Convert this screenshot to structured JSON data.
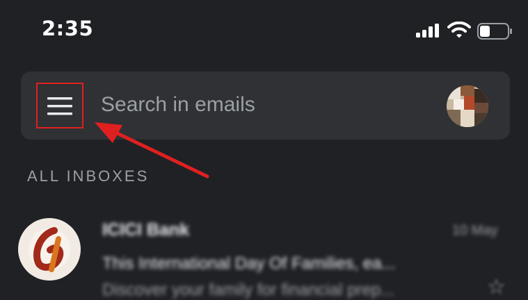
{
  "status_bar": {
    "time": "2:35",
    "icons": [
      "cellular-signal-icon",
      "wifi-icon",
      "battery-icon"
    ]
  },
  "search_bar": {
    "menu_icon": "hamburger-menu-icon",
    "placeholder": "Search in emails",
    "avatar_icon": "account-avatar"
  },
  "section_title": "ALL INBOXES",
  "emails": [
    {
      "sender": "ICICI Bank",
      "time": "10 May",
      "subject": "This International Day Of Families, ea...",
      "snippet": "Discover your family for financial prep..."
    }
  ],
  "colors": {
    "background": "#202124",
    "search_bar": "#303134",
    "highlight": "#e02020",
    "text_secondary": "#9aa0a6"
  }
}
